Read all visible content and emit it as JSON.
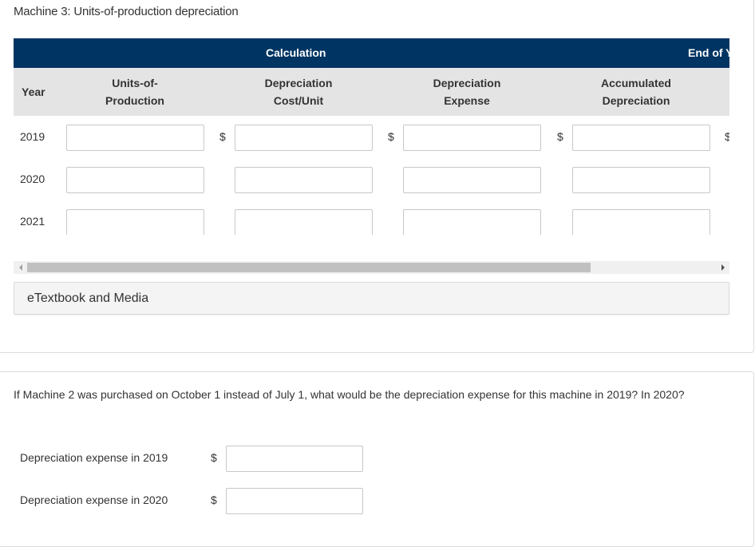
{
  "section_title": "Machine 3: Units-of-production depreciation",
  "table": {
    "group_headers": {
      "calculation": "Calculation",
      "end_of_year": "End of Y"
    },
    "columns": {
      "year": "Year",
      "units_line1": "Units-of-",
      "units_line2": "Production",
      "cost_line1": "Depreciation",
      "cost_line2": "Cost/Unit",
      "expense_line1": "Depreciation",
      "expense_line2": "Expense",
      "accum_line1": "Accumulated",
      "accum_line2": "Depreciation"
    },
    "currency_symbol": "$",
    "rows": [
      {
        "year": "2019",
        "units": "",
        "cost_per_unit": "",
        "expense": "",
        "accumulated": ""
      },
      {
        "year": "2020",
        "units": "",
        "cost_per_unit": "",
        "expense": "",
        "accumulated": ""
      },
      {
        "year": "2021",
        "units": "",
        "cost_per_unit": "",
        "expense": "",
        "accumulated": ""
      }
    ]
  },
  "etextbook_label": "eTextbook and Media",
  "question": {
    "text": "If Machine 2 was purchased on October 1 instead of July 1, what would be the depreciation expense for this machine in 2019? In 2020?",
    "fields": [
      {
        "label": "Depreciation expense in 2019",
        "currency": "$",
        "value": ""
      },
      {
        "label": "Depreciation expense in 2020",
        "currency": "$",
        "value": ""
      }
    ]
  },
  "colors": {
    "header_navy": "#003462",
    "subheader_gray": "#e4e4e4"
  }
}
